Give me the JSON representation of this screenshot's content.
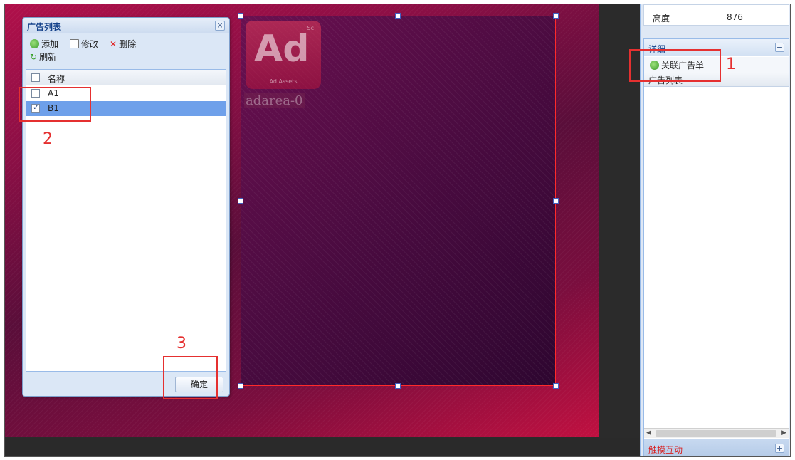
{
  "dialog": {
    "title": "广告列表",
    "close_glyph": "×",
    "toolbar": {
      "add": "添加",
      "edit": "修改",
      "delete": "删除",
      "refresh": "刷新"
    },
    "grid": {
      "column_name": "名称",
      "rows": [
        {
          "name": "A1",
          "checked": false
        },
        {
          "name": "B1",
          "checked": true
        }
      ]
    },
    "ok_label": "确定"
  },
  "canvas": {
    "ad_area_label": "adarea-0",
    "ad_logo_text": "Ad"
  },
  "right_panel": {
    "property": {
      "name": "高度",
      "value": "876"
    },
    "detail_title": "详细",
    "collapse_glyph": "−",
    "associate_button": "关联广告单",
    "list_header": "广告列表",
    "touch_section": "触摸互动",
    "expand_glyph": "+"
  },
  "annotations": {
    "step1": "1",
    "step2": "2",
    "step3": "3"
  },
  "colors": {
    "annotation_red": "#e53030",
    "selection_blue": "#6ea0ea",
    "title_blue": "#15428b"
  }
}
